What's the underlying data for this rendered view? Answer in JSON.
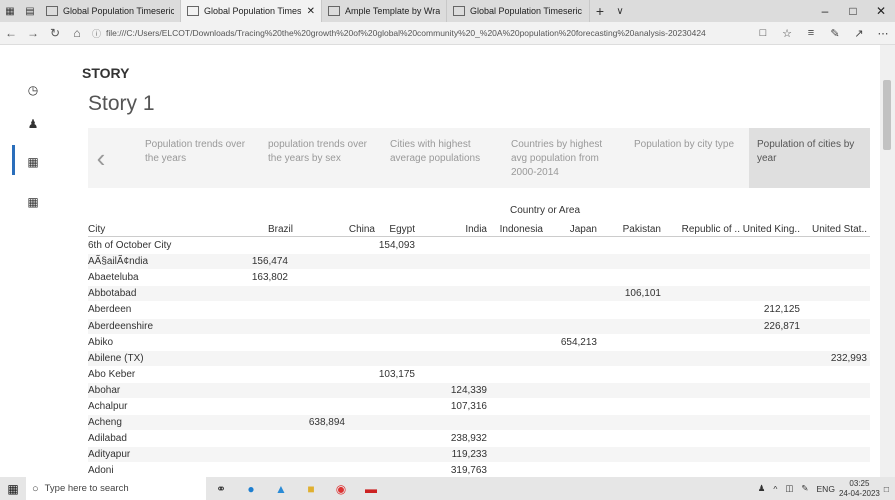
{
  "browser": {
    "tabs": [
      {
        "label": "Global Population Timeseric",
        "active": false
      },
      {
        "label": "Global Population Timesі",
        "active": true
      },
      {
        "label": "Ample Template by WrapPo",
        "active": false
      },
      {
        "label": "Global Population Timeseric",
        "active": false
      }
    ],
    "new_tab": "+",
    "dropdown": "∨",
    "window_controls": [
      "–",
      "□",
      "✕"
    ],
    "url": "file:///C:/Users/ELCOT/Downloads/Tracing%20the%20growth%20of%20global%20community%20_%20A%20population%20forecasting%20analysis-20230424",
    "nav": {
      "back": "←",
      "forward": "→",
      "refresh": "↻",
      "home": "⌂"
    }
  },
  "sidebar": {
    "icons": [
      "clock-icon",
      "user-icon",
      "grid-icon",
      "table-icon"
    ]
  },
  "story": {
    "header": "STORY",
    "title": "Story 1",
    "prev": "‹",
    "points": [
      {
        "label": "Population trends over the years",
        "lines": [
          "Population trends over",
          "the years"
        ]
      },
      {
        "label": "population trends over the years by sex",
        "lines": [
          "population trends over",
          "the years by sex"
        ]
      },
      {
        "label": "Cities with highest average populations",
        "lines": [
          "Cities with highest",
          "average populations"
        ]
      },
      {
        "label": "Countries by highest avg population from 2000-2014",
        "lines": [
          "Countries by highest",
          "avg population from",
          "2000-2014"
        ]
      },
      {
        "label": "Population by city type",
        "lines": [
          "Population by city type"
        ]
      },
      {
        "label": "Population of cities by year",
        "lines": [
          "Population of cities by",
          "year"
        ],
        "selected": true
      }
    ]
  },
  "table": {
    "column_group": "Country or Area",
    "row_header": "City",
    "columns": [
      "Brazil",
      "China",
      "Egypt",
      "India",
      "Indonesia",
      "Japan",
      "Pakistan",
      "Republic of ..",
      "United King..",
      "United Stat.."
    ],
    "rows": [
      {
        "city": "6th of October City",
        "vals": [
          "",
          "",
          "154,093",
          "",
          "",
          "",
          "",
          "",
          "",
          ""
        ]
      },
      {
        "city": "AÃ§ailÃ¢ndia",
        "vals": [
          "156,474",
          "",
          "",
          "",
          "",
          "",
          "",
          "",
          "",
          ""
        ]
      },
      {
        "city": "Abaeteluba",
        "vals": [
          "163,802",
          "",
          "",
          "",
          "",
          "",
          "",
          "",
          "",
          ""
        ]
      },
      {
        "city": "Abbotabad",
        "vals": [
          "",
          "",
          "",
          "",
          "",
          "",
          "106,101",
          "",
          "",
          ""
        ]
      },
      {
        "city": "Aberdeen",
        "vals": [
          "",
          "",
          "",
          "",
          "",
          "",
          "",
          "",
          "212,125",
          ""
        ]
      },
      {
        "city": "Aberdeenshire",
        "vals": [
          "",
          "",
          "",
          "",
          "",
          "",
          "",
          "",
          "226,871",
          ""
        ]
      },
      {
        "city": "Abiko",
        "vals": [
          "",
          "",
          "",
          "",
          "",
          "654,213",
          "",
          "",
          "",
          ""
        ]
      },
      {
        "city": "Abilene (TX)",
        "vals": [
          "",
          "",
          "",
          "",
          "",
          "",
          "",
          "",
          "",
          "232,993"
        ]
      },
      {
        "city": "Abo Keber",
        "vals": [
          "",
          "",
          "103,175",
          "",
          "",
          "",
          "",
          "",
          "",
          ""
        ]
      },
      {
        "city": "Abohar",
        "vals": [
          "",
          "",
          "",
          "124,339",
          "",
          "",
          "",
          "",
          "",
          ""
        ]
      },
      {
        "city": "Achalpur",
        "vals": [
          "",
          "",
          "",
          "107,316",
          "",
          "",
          "",
          "",
          "",
          ""
        ]
      },
      {
        "city": "Acheng",
        "vals": [
          "",
          "638,894",
          "",
          "",
          "",
          "",
          "",
          "",
          "",
          ""
        ]
      },
      {
        "city": "Adilabad",
        "vals": [
          "",
          "",
          "",
          "238,932",
          "",
          "",
          "",
          "",
          "",
          ""
        ]
      },
      {
        "city": "Adityapur",
        "vals": [
          "",
          "",
          "",
          "119,233",
          "",
          "",
          "",
          "",
          "",
          ""
        ]
      },
      {
        "city": "Adoni",
        "vals": [
          "",
          "",
          "",
          "319,763",
          "",
          "",
          "",
          "",
          "",
          ""
        ]
      }
    ]
  },
  "taskbar": {
    "search_placeholder": "Type here to search",
    "tray": {
      "lang": "ENG",
      "time": "03:25",
      "date": "24-04-2023"
    }
  }
}
